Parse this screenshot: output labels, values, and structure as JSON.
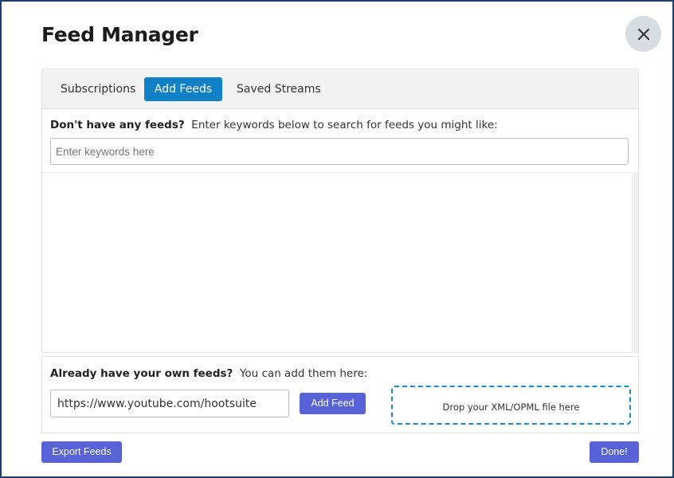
{
  "dialog": {
    "title": "Feed Manager",
    "close_icon": "close-icon"
  },
  "tabs": [
    {
      "label": "Subscriptions",
      "active": false
    },
    {
      "label": "Add Feeds",
      "active": true
    },
    {
      "label": "Saved Streams",
      "active": false
    }
  ],
  "search": {
    "prompt_bold": "Don't have any feeds?",
    "prompt_text": "Enter keywords below to search for feeds you might like:",
    "placeholder": "Enter keywords here",
    "value": ""
  },
  "own_feeds": {
    "prompt_bold": "Already have your own feeds?",
    "prompt_text": "You can add them here:",
    "url_value": "https://www.youtube.com/hootsuite",
    "add_label": "Add Feed",
    "dropzone_text": "Drop your XML/OPML file here"
  },
  "footer": {
    "export_label": "Export Feeds",
    "done_label": "Done!"
  },
  "colors": {
    "accent_tab": "#1081c7",
    "button": "#5763d6",
    "dropzone_border": "#1a8ad0",
    "frame_border": "#1c3f6e"
  }
}
